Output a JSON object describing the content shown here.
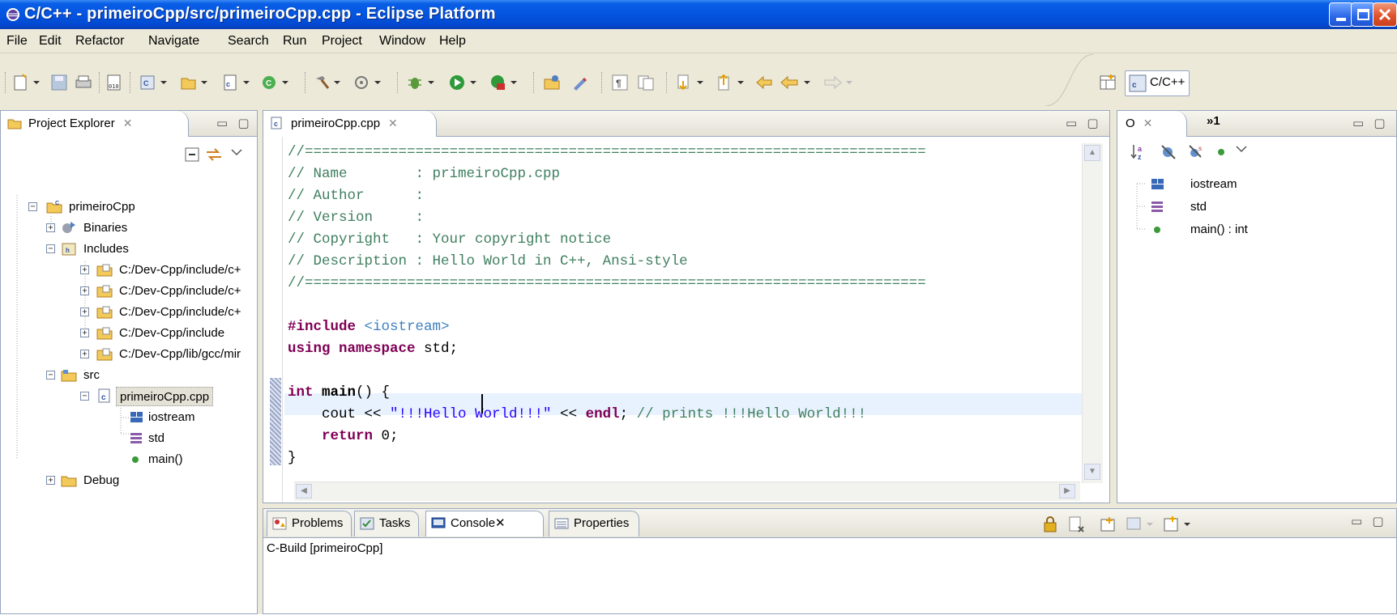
{
  "window": {
    "title": "C/C++ - primeiroCpp/src/primeiroCpp.cpp - Eclipse Platform"
  },
  "menu": [
    "File",
    "Edit",
    "Refactor",
    "Navigate",
    "Search",
    "Run",
    "Project",
    "Window",
    "Help"
  ],
  "perspective": {
    "label": "C/C++"
  },
  "project_explorer": {
    "tab_label": "Project Explorer",
    "tree": {
      "project": "primeiroCpp",
      "binaries": "Binaries",
      "includes": "Includes",
      "include_paths": [
        "C:/Dev-Cpp/include/c+",
        "C:/Dev-Cpp/include/c+",
        "C:/Dev-Cpp/include/c+",
        "C:/Dev-Cpp/include",
        "C:/Dev-Cpp/lib/gcc/mir"
      ],
      "src": "src",
      "file": "primeiroCpp.cpp",
      "file_children": [
        "iostream",
        "std",
        "main()"
      ],
      "debug": "Debug"
    }
  },
  "editor": {
    "tab_label": "primeiroCpp.cpp",
    "rule": "//=========================================================================",
    "header_comments": [
      "// Name        : primeiroCpp.cpp",
      "// Author      :",
      "// Version     :",
      "// Copyright   : Your copyright notice",
      "// Description : Hello World in C++, Ansi-style"
    ],
    "include_kw": "#include",
    "include_target": "<iostream>",
    "using_kw": "using namespace",
    "using_rest": " std;",
    "main_kw": "int",
    "main_name": "main",
    "main_rest": "() {",
    "cout_a": "    cout << ",
    "cout_str": "\"!!!Hello World!!!\"",
    "cout_b": " << ",
    "cout_endl": "endl",
    "cout_c": "; ",
    "cout_comment": "// prints !!!Hello World!!!",
    "return_kw": "    return",
    "return_rest": " 0;",
    "close_brace": "}"
  },
  "outline": {
    "tab_label": "O",
    "extra_tab": "»1",
    "items": [
      "iostream",
      "std",
      "main() : int"
    ]
  },
  "bottom_panel": {
    "tabs": [
      "Problems",
      "Tasks",
      "Console",
      "Properties"
    ],
    "console_text": "C-Build [primeiroCpp]"
  },
  "colors": {
    "titlebar": "#0454e0",
    "keyword": "#7f0055",
    "string": "#2a00ff",
    "comment": "#3f7f5f",
    "current_line": "#e8f2fe"
  }
}
